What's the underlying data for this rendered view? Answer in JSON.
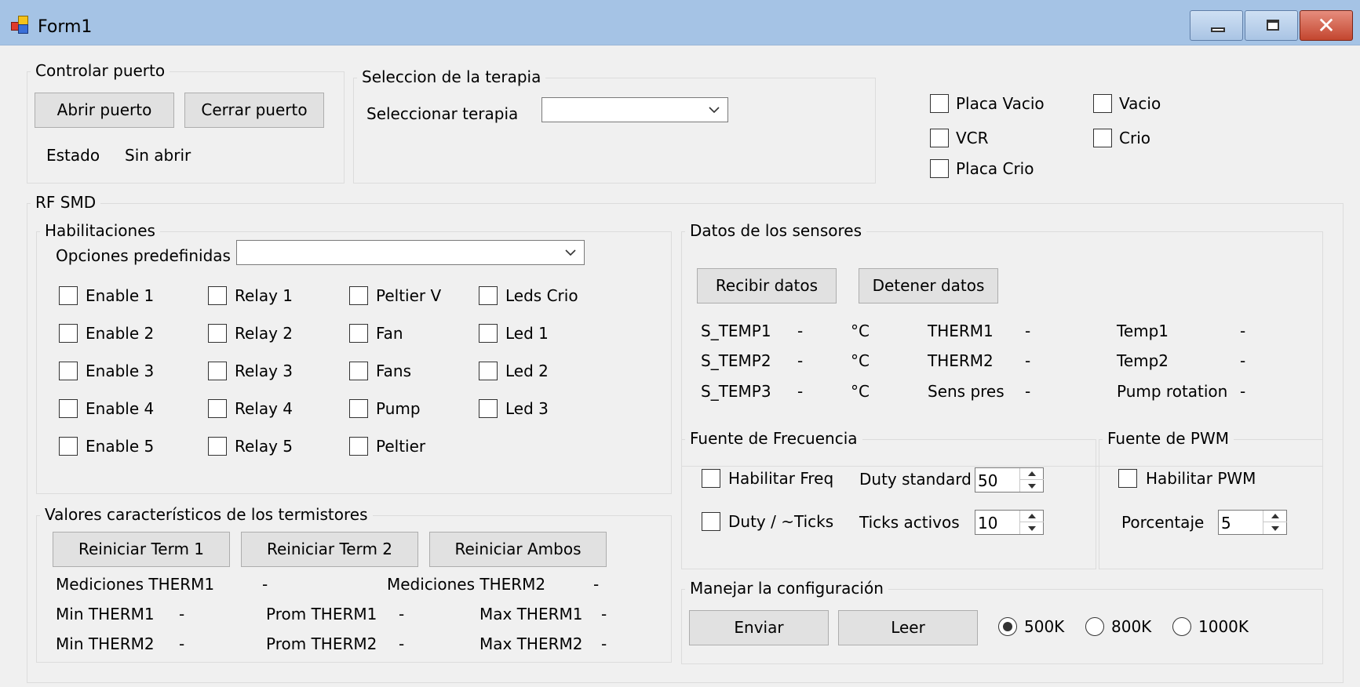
{
  "window": {
    "title": "Form1"
  },
  "puerto": {
    "legend": "Controlar puerto",
    "open_label": "Abrir puerto",
    "close_label": "Cerrar puerto",
    "status_label": "Estado",
    "status_value": "Sin abrir"
  },
  "terapia": {
    "legend": "Seleccion de la terapia",
    "select_label": "Seleccionar terapia",
    "select_value": ""
  },
  "placas": [
    {
      "label": "Placa Vacio",
      "checked": false
    },
    {
      "label": "Vacio",
      "checked": false
    },
    {
      "label": "VCR",
      "checked": false
    },
    {
      "label": "Crio",
      "checked": false
    },
    {
      "label": "Placa Crio",
      "checked": false
    }
  ],
  "rf": {
    "legend": "RF SMD",
    "habilitaciones": {
      "legend": "Habilitaciones",
      "preset_label": "Opciones predefinidas",
      "preset_value": "",
      "columns": [
        [
          "Enable 1",
          "Enable 2",
          "Enable 3",
          "Enable 4",
          "Enable 5"
        ],
        [
          "Relay 1",
          "Relay 2",
          "Relay 3",
          "Relay 4",
          "Relay 5"
        ],
        [
          "Peltier V",
          "Fan",
          "Fans",
          "Pump",
          "Peltier"
        ],
        [
          "Leds Crio",
          "Led 1",
          "Led 2",
          "Led 3"
        ]
      ]
    },
    "termistores": {
      "legend": "Valores característicos de los termistores",
      "reset1": "Reiniciar Term 1",
      "reset2": "Reiniciar Term 2",
      "reset_both": "Reiniciar Ambos",
      "med1_label": "Mediciones THERM1",
      "med1_value": "-",
      "med2_label": "Mediciones THERM2",
      "med2_value": "-",
      "min1_label": "Min THERM1",
      "min1_value": "-",
      "prom1_label": "Prom THERM1",
      "prom1_value": "-",
      "max1_label": "Max THERM1",
      "max1_value": "-",
      "min2_label": "Min THERM2",
      "min2_value": "-",
      "prom2_label": "Prom THERM2",
      "prom2_value": "-",
      "max2_label": "Max THERM2",
      "max2_value": "-"
    },
    "sensores": {
      "legend": "Datos de los sensores",
      "receive_label": "Recibir datos",
      "stop_label": "Detener datos",
      "rows": [
        {
          "s_label": "S_TEMP1",
          "s_value": "-",
          "unit": "°C",
          "t_label": "THERM1",
          "t_value": "-",
          "x_label": "Temp1",
          "x_value": "-"
        },
        {
          "s_label": "S_TEMP2",
          "s_value": "-",
          "unit": "°C",
          "t_label": "THERM2",
          "t_value": "-",
          "x_label": "Temp2",
          "x_value": "-"
        },
        {
          "s_label": "S_TEMP3",
          "s_value": "-",
          "unit": "°C",
          "t_label": "Sens pres",
          "t_value": "-",
          "x_label": "Pump rotation",
          "x_value": "-"
        }
      ]
    },
    "frecuencia": {
      "legend": "Fuente de Frecuencia",
      "enable_label": "Habilitar Freq",
      "duty_ticks_label": "Duty / ~Ticks",
      "duty_std_label": "Duty standard",
      "duty_std_value": "50",
      "ticks_label": "Ticks activos",
      "ticks_value": "10"
    },
    "pwm": {
      "legend": "Fuente de PWM",
      "enable_label": "Habilitar PWM",
      "pct_label": "Porcentaje",
      "pct_value": "5"
    },
    "config": {
      "legend": "Manejar la configuración",
      "send_label": "Enviar",
      "read_label": "Leer",
      "rates": [
        {
          "label": "500K",
          "selected": true
        },
        {
          "label": "800K",
          "selected": false
        },
        {
          "label": "1000K",
          "selected": false
        }
      ]
    }
  }
}
